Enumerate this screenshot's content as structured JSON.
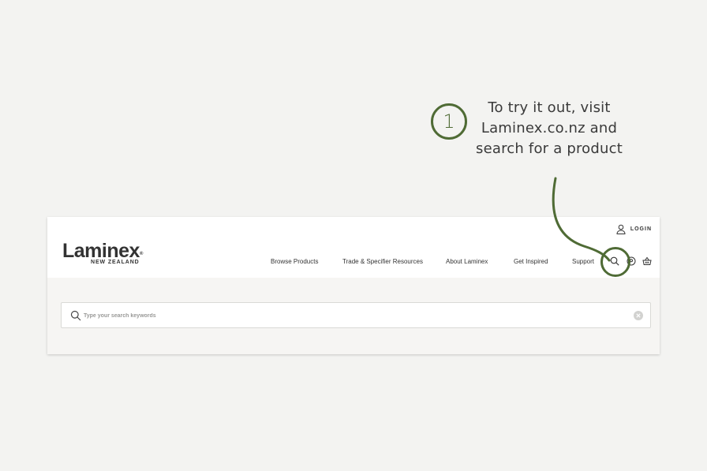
{
  "callout": {
    "number": "1",
    "lines": [
      "To try it out, visit",
      "Laminex.co.nz and",
      "search for a product"
    ]
  },
  "site": {
    "logo": {
      "main": "Laminex",
      "registered": "®",
      "sub": "NEW ZEALAND"
    },
    "login_label": "LOGIN",
    "nav": [
      {
        "label": "Browse Products"
      },
      {
        "label": "Trade & Specifier Resources"
      },
      {
        "label": "About Laminex"
      },
      {
        "label": "Get Inspired"
      },
      {
        "label": "Support"
      }
    ],
    "icons": {
      "search": "search-icon",
      "location": "location-pin-icon",
      "basket": "basket-icon",
      "user": "user-icon",
      "clear": "clear-icon"
    },
    "search": {
      "placeholder": "Type your search keywords",
      "value": ""
    }
  },
  "colors": {
    "accent": "#4f6b35",
    "background": "#f3f3f1"
  }
}
